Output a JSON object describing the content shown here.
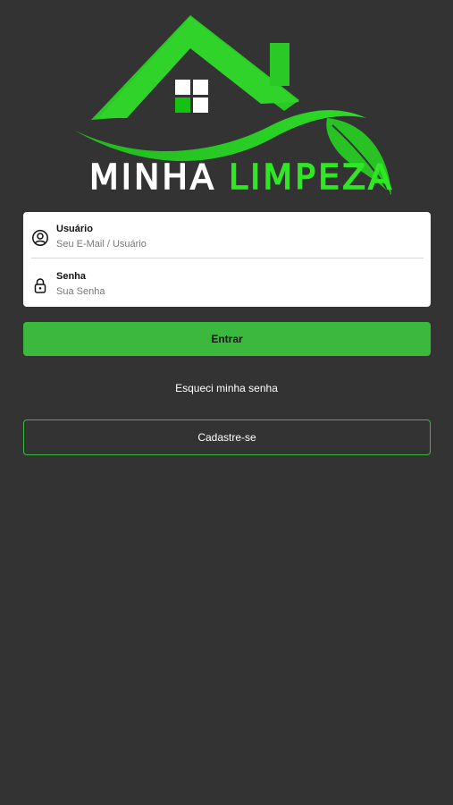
{
  "logo": {
    "word1": "MINHA",
    "word2": "LIMPEZA",
    "icon": "house-with-leaf-logo",
    "colors": {
      "green": "#2ecc2a",
      "dark_green": "#1ea81c",
      "white": "#ffffff"
    }
  },
  "login_form": {
    "user": {
      "label": "Usuário",
      "placeholder": "Seu E-Mail / Usuário",
      "value": "",
      "icon": "user-circle-icon"
    },
    "password": {
      "label": "Senha",
      "placeholder": "Sua Senha",
      "value": "",
      "icon": "lock-icon"
    }
  },
  "actions": {
    "login_label": "Entrar",
    "forgot_label": "Esqueci minha senha",
    "register_label": "Cadastre-se"
  },
  "theme": {
    "background": "#333333",
    "accent": "#3db83f",
    "card": "#ffffff"
  }
}
